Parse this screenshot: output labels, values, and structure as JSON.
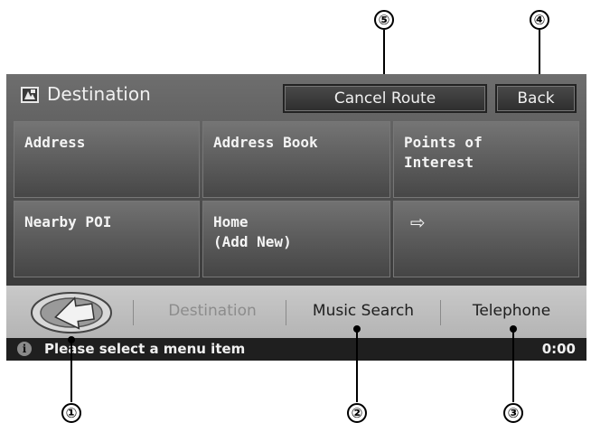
{
  "header": {
    "title": "Destination",
    "cancel_route_label": "Cancel Route",
    "back_label": "Back"
  },
  "grid": [
    {
      "label": "Address"
    },
    {
      "label": "Address Book"
    },
    {
      "label": "Points of\nInterest"
    },
    {
      "label": "Nearby POI"
    },
    {
      "label": "Home\n(Add New)"
    },
    {
      "label": "⇨"
    }
  ],
  "tabs": {
    "destination": "Destination",
    "music_search": "Music Search",
    "telephone": "Telephone"
  },
  "status": {
    "info_icon": "i",
    "message": "Please select a menu item",
    "time": "0:00"
  },
  "callouts": {
    "c1": "①",
    "c2": "②",
    "c3": "③",
    "c4": "④",
    "c5": "⑤"
  },
  "icons": [
    "map-icon",
    "navigation-home-icon",
    "info-icon"
  ]
}
